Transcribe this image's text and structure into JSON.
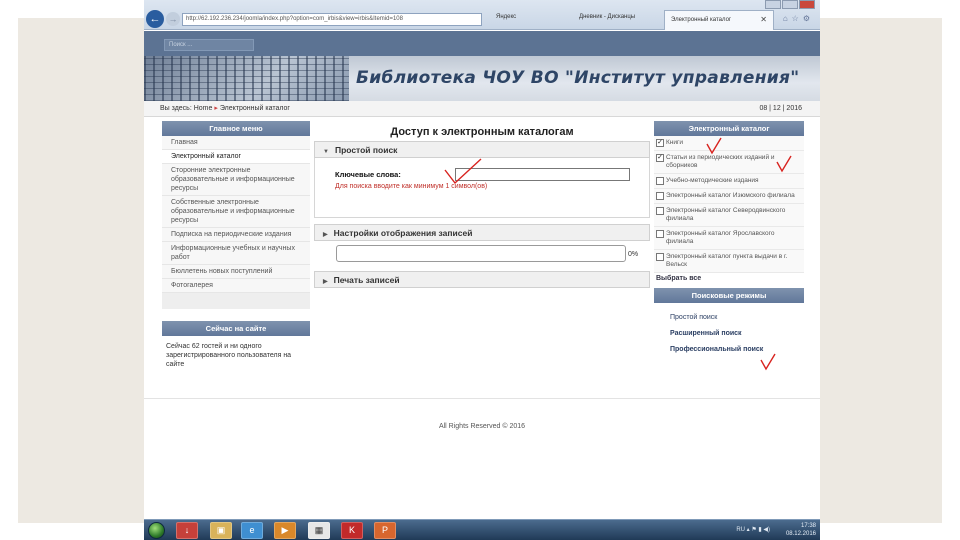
{
  "browser": {
    "url": "http://62.192.236.234/joomla/index.php?option=com_irbis&view=irbis&Itemid=108",
    "tabs_other": [
      "Яндекс",
      "Дневник - Дисканцы"
    ],
    "active_tab": "Электронный каталог",
    "close_glyph": "✕"
  },
  "site": {
    "search_placeholder": "Поиск ...",
    "banner_title": "Библиотека ЧОУ ВО \"Институт управления\"",
    "breadcrumb_prefix": "Вы здесь:",
    "breadcrumb_home": "Home",
    "breadcrumb_sep": "▸",
    "breadcrumb_current": "Электронный каталог",
    "date": "08 | 12 | 2016"
  },
  "left_menu": {
    "title": "Главное меню",
    "items": [
      "Главная",
      "Электронный каталог",
      "Сторонние электронные образовательные и информационные ресурсы",
      "Собственные электронные образовательные и информационные ресурсы",
      "Подписка на периодические издания",
      "Информационные учебных и научных работ",
      "Бюллетень новых поступлений",
      "Фотогалерея"
    ]
  },
  "online": {
    "title": "Сейчас на сайте",
    "text": "Сейчас 62 гостей и ни одного зарегистрированного пользователя на сайте"
  },
  "center": {
    "title": "Доступ к электронным каталогам",
    "simple_search": "Простой поиск",
    "keywords_label": "Ключевые слова:",
    "keywords_value": "",
    "hint": "Для поиска вводите как минимум 1 символ(ов)",
    "display_settings": "Настройки отображения записей",
    "progress": 0,
    "progress_text": "0%",
    "print_records": "Печать записей",
    "triangle_open": "▼",
    "triangle_closed": "▶"
  },
  "catalog": {
    "title": "Электронный каталог",
    "items": [
      {
        "label": "Книги",
        "checked": true
      },
      {
        "label": "Статьи из периодических изданий и сборников",
        "checked": true
      },
      {
        "label": "Учебно-методические издания",
        "checked": false
      },
      {
        "label": "Электронный каталог Изюмского филиала",
        "checked": false
      },
      {
        "label": "Электронный каталог Северодвинского филиала",
        "checked": false
      },
      {
        "label": "Электронный каталог Ярославского филиала",
        "checked": false
      },
      {
        "label": "Электронный каталог пункта выдачи в г. Вельск",
        "checked": false
      }
    ],
    "select_all": "Выбрать все"
  },
  "modes": {
    "title": "Поисковые режимы",
    "items": [
      "Простой поиск",
      "Расширенный поиск",
      "Профессиональный поиск"
    ]
  },
  "footer": {
    "copyright": "All Rights Reserved © 2016"
  },
  "taskbar": {
    "time": "17:38",
    "date": "08.12.2016",
    "lang": "RU"
  },
  "colors": {
    "accent": "#61779a",
    "hint": "#c0302a",
    "annotation": "#d8231f"
  }
}
